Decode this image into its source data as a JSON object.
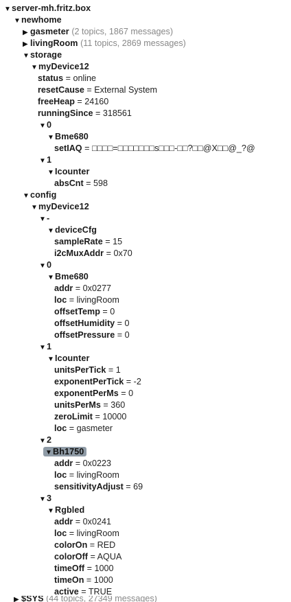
{
  "tree": {
    "root": {
      "label": "server-mh.fritz.box",
      "expanded": true
    },
    "newhome": {
      "label": "newhome",
      "gasmeter": {
        "label": "gasmeter",
        "meta": "(2 topics, 1867 messages)"
      },
      "livingRoom": {
        "label": "livingRoom",
        "meta": "(11 topics, 2869 messages)"
      },
      "storage": {
        "label": "storage",
        "device": {
          "label": "myDevice12",
          "status": {
            "key": "status",
            "value": "online"
          },
          "resetCause": {
            "key": "resetCause",
            "value": "External System"
          },
          "freeHeap": {
            "key": "freeHeap",
            "value": "24160"
          },
          "runningSince": {
            "key": "runningSince",
            "value": "318561"
          },
          "n0": {
            "label": "0",
            "sensor": {
              "label": "Bme680",
              "setIAQ": {
                "key": "setIAQ",
                "value": "□□□□=□□□□□□□s□□□-□□?□□@X□□@_?@"
              }
            }
          },
          "n1": {
            "label": "1",
            "sensor": {
              "label": "Icounter",
              "absCnt": {
                "key": "absCnt",
                "value": "598"
              }
            }
          }
        }
      },
      "config": {
        "label": "config",
        "device": {
          "label": "myDevice12",
          "dash": {
            "label": "-",
            "cfg": {
              "label": "deviceCfg",
              "sampleRate": {
                "key": "sampleRate",
                "value": "15"
              },
              "i2cMuxAddr": {
                "key": "i2cMuxAddr",
                "value": "0x70"
              }
            }
          },
          "n0": {
            "label": "0",
            "sensor": {
              "label": "Bme680",
              "addr": {
                "key": "addr",
                "value": "0x0277"
              },
              "loc": {
                "key": "loc",
                "value": "livingRoom"
              },
              "offsetTemp": {
                "key": "offsetTemp",
                "value": "0"
              },
              "offsetHumidity": {
                "key": "offsetHumidity",
                "value": "0"
              },
              "offsetPressure": {
                "key": "offsetPressure",
                "value": "0"
              }
            }
          },
          "n1": {
            "label": "1",
            "sensor": {
              "label": "Icounter",
              "unitsPerTick": {
                "key": "unitsPerTick",
                "value": "1"
              },
              "exponentPerTick": {
                "key": "exponentPerTick",
                "value": "-2"
              },
              "exponentPerMs": {
                "key": "exponentPerMs",
                "value": "0"
              },
              "unitsPerMs": {
                "key": "unitsPerMs",
                "value": "360"
              },
              "zeroLimit": {
                "key": "zeroLimit",
                "value": "10000"
              },
              "loc": {
                "key": "loc",
                "value": "gasmeter"
              }
            }
          },
          "n2": {
            "label": "2",
            "sensor": {
              "label": "Bh1750",
              "selected": true,
              "addr": {
                "key": "addr",
                "value": "0x0223"
              },
              "loc": {
                "key": "loc",
                "value": "livingRoom"
              },
              "sensitivityAdjust": {
                "key": "sensitivityAdjust",
                "value": "69"
              }
            }
          },
          "n3": {
            "label": "3",
            "sensor": {
              "label": "Rgbled",
              "addr": {
                "key": "addr",
                "value": "0x0241"
              },
              "loc": {
                "key": "loc",
                "value": "livingRoom"
              },
              "colorOn": {
                "key": "colorOn",
                "value": "RED"
              },
              "colorOff": {
                "key": "colorOff",
                "value": "AQUA"
              },
              "timeOff": {
                "key": "timeOff",
                "value": "1000"
              },
              "timeOn": {
                "key": "timeOn",
                "value": "1000"
              },
              "active": {
                "key": "active",
                "value": "TRUE"
              }
            }
          }
        }
      }
    },
    "sys": {
      "label": "$SYS",
      "meta": "(44 topics, 27349 messages)"
    },
    "toggles": {
      "expanded": "▼",
      "collapsed": "▶"
    },
    "eq": " = "
  }
}
